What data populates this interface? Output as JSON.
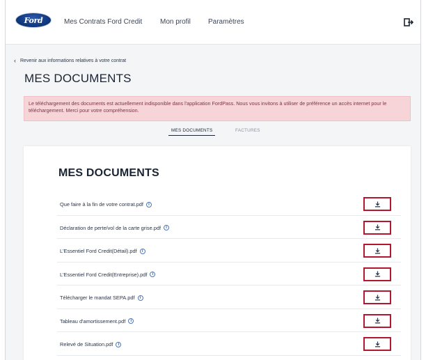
{
  "brand": {
    "logo_text": "Ford"
  },
  "nav": {
    "items": [
      {
        "label": "Mes Contrats Ford Credit"
      },
      {
        "label": "Mon profil"
      },
      {
        "label": "Paramètres"
      }
    ]
  },
  "back_link": "Revenir aux informations relatives à votre contrat",
  "page_title": "MES DOCUMENTS",
  "alert": "Le téléchargement des documents est actuellement indisponible dans l'application FordPass. Nous vous invitons à utiliser de préférence un accès internet pour le téléchargement. Merci pour votre compréhension.",
  "tabs": [
    {
      "label": "MES DOCUMENTS",
      "active": true
    },
    {
      "label": "FACTURES",
      "active": false
    }
  ],
  "card": {
    "title": "MES DOCUMENTS",
    "documents": [
      {
        "name": "Que faire à la fin de votre contrat.pdf"
      },
      {
        "name": "Déclaration de perte/vol de la carte grise.pdf"
      },
      {
        "name": "L'Essentiel Ford Credit(Détail).pdf"
      },
      {
        "name": "L'Essentiel Ford Credit(Entreprise).pdf"
      },
      {
        "name": "Télécharger le mandat SEPA.pdf"
      },
      {
        "name": "Tableau d'amortissement.pdf"
      },
      {
        "name": "Relevé de Situation.pdf"
      }
    ]
  },
  "colors": {
    "brand_blue": "#123b84",
    "alert_bg": "#f6d4d7",
    "highlight": "#b3172f"
  },
  "icons": {
    "info": "info-icon",
    "download": "download-icon",
    "logout": "logout-icon",
    "back": "chevron-left-icon"
  }
}
